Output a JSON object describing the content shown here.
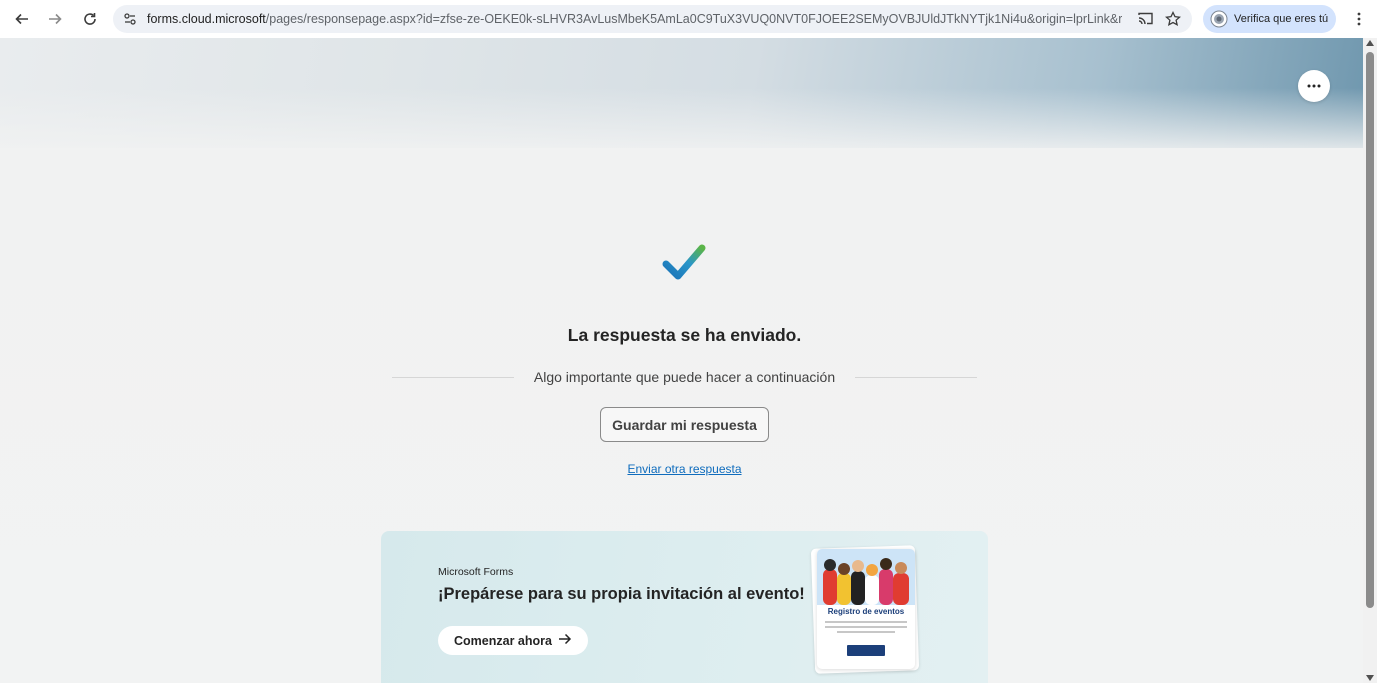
{
  "browser": {
    "url_host": "forms.cloud.microsoft",
    "url_path": "/pages/responsepage.aspx?id=zfse-ze-OEKE0k-sLHVR3AvLusMbeK5AmLa0C9TuX3VUQ0NVT0FJOEE2SEMyOVBJUldJTkNYTjk1Ni4u&origin=lprLink&route...",
    "profile_label": "Verifica que eres tú"
  },
  "response": {
    "title": "La respuesta se ha enviado.",
    "next_steps": "Algo importante que puede hacer a continuación",
    "save_button": "Guardar mi respuesta",
    "send_another": "Enviar otra respuesta"
  },
  "promo": {
    "brand": "Microsoft Forms",
    "title": "¡Prepárese para su propia invitación al evento!",
    "button": "Comenzar ahora",
    "card_title": "Registro de eventos"
  },
  "colors": {
    "link": "#0f6cbd",
    "check_blue": "#1a73b8",
    "check_green": "#5bb548",
    "card_cta": "#1c3f7a"
  },
  "icons": [
    "back-icon",
    "forward-icon",
    "reload-icon",
    "site-info-icon",
    "cast-icon",
    "star-icon",
    "profile-icon",
    "kebab-icon",
    "more-icon",
    "check-icon",
    "arrow-right-icon"
  ]
}
